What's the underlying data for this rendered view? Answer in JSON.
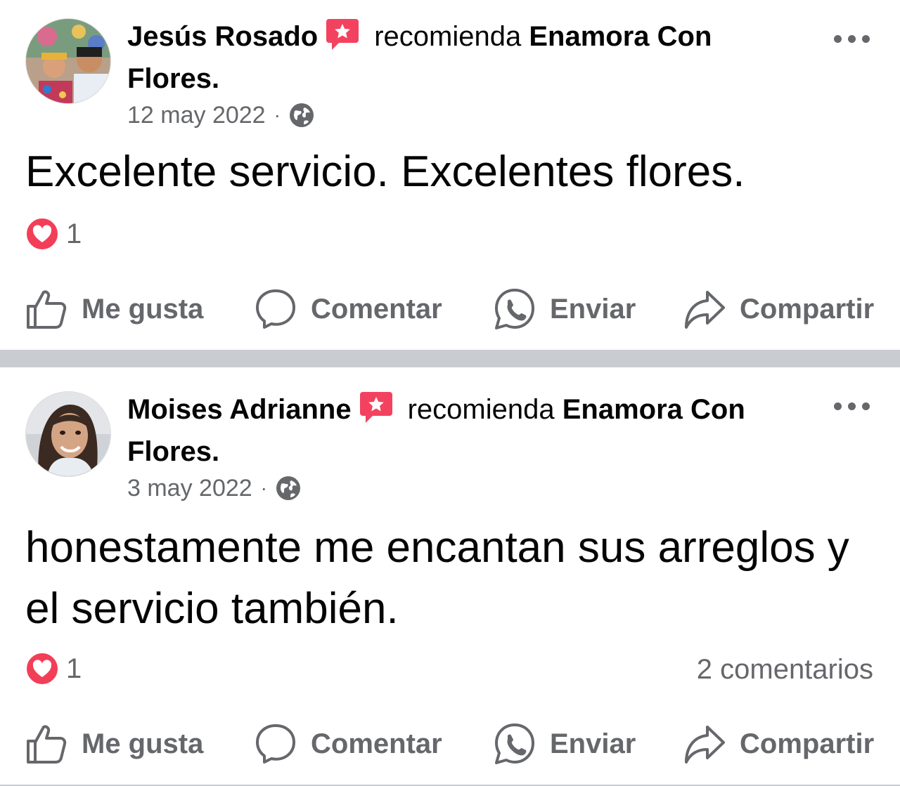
{
  "posts": [
    {
      "author": "Jesús Rosado",
      "verb": "recomienda",
      "page": "Enamora Con Flores",
      "date": "12 may 2022",
      "text": "Excelente servicio. Excelentes flores.",
      "reactions": "1",
      "comments": ""
    },
    {
      "author": "Moises Adrianne",
      "verb": "recomienda",
      "page": "Enamora Con Flores",
      "date": "3 may 2022",
      "text": "honestamente me encantan sus arreglos y el servicio también.",
      "reactions": "1",
      "comments": "2 comentarios"
    }
  ],
  "actions": {
    "like": "Me gusta",
    "comment": "Comentar",
    "send": "Enviar",
    "share": "Compartir"
  },
  "icons": {
    "badge": "recommendation-badge-icon",
    "privacy": "globe-icon",
    "reaction": "love-heart-icon",
    "more": "more-options-icon"
  },
  "colors": {
    "badge": "#f3425f",
    "heart": "#f33e58",
    "secondary_text": "#65676b",
    "separator": "#c9ccd1"
  }
}
